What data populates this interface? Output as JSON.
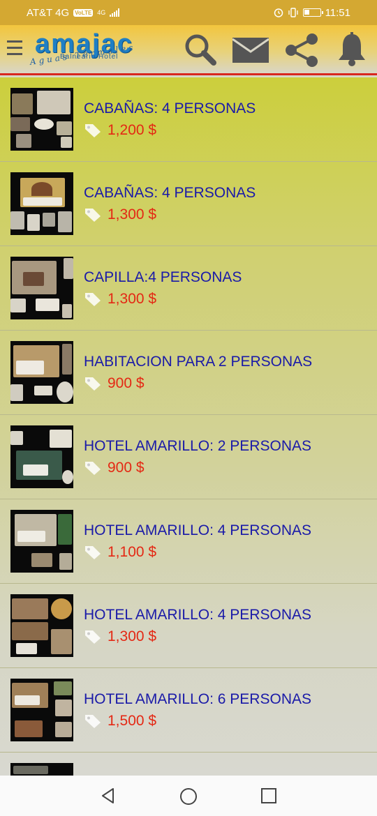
{
  "status_bar": {
    "carrier": "AT&T 4G",
    "volte": "VoLTE",
    "network": "4G",
    "time": "11:51"
  },
  "header": {
    "logo_text": "amajac",
    "logo_subtitle": "Balneario  Hotel",
    "logo_tagline": "Aguas Termales",
    "accent_color": "#d8271e"
  },
  "listings": [
    {
      "title": "CABAÑAS: 4 PERSONAS",
      "price": "1,200 $"
    },
    {
      "title": "CABAÑAS: 4 PERSONAS",
      "price": "1,300 $"
    },
    {
      "title": "CAPILLA:4 PERSONAS",
      "price": "1,300 $"
    },
    {
      "title": "HABITACION PARA 2 PERSONAS",
      "price": "900 $"
    },
    {
      "title": "HOTEL AMARILLO: 2 PERSONAS",
      "price": "900 $"
    },
    {
      "title": "HOTEL AMARILLO: 4 PERSONAS",
      "price": "1,100 $"
    },
    {
      "title": "HOTEL AMARILLO: 4 PERSONAS",
      "price": "1,300 $"
    },
    {
      "title": "HOTEL AMARILLO: 6 PERSONAS",
      "price": "1,500 $"
    },
    {
      "title": "",
      "price": ""
    }
  ],
  "icons": {
    "menu": "hamburger-icon",
    "search": "search-icon",
    "mail": "mail-icon",
    "share": "share-icon",
    "notifications": "bell-icon",
    "price_tag": "tag-icon",
    "nav_back": "back-triangle-icon",
    "nav_home": "home-circle-icon",
    "nav_recents": "recents-square-icon"
  }
}
